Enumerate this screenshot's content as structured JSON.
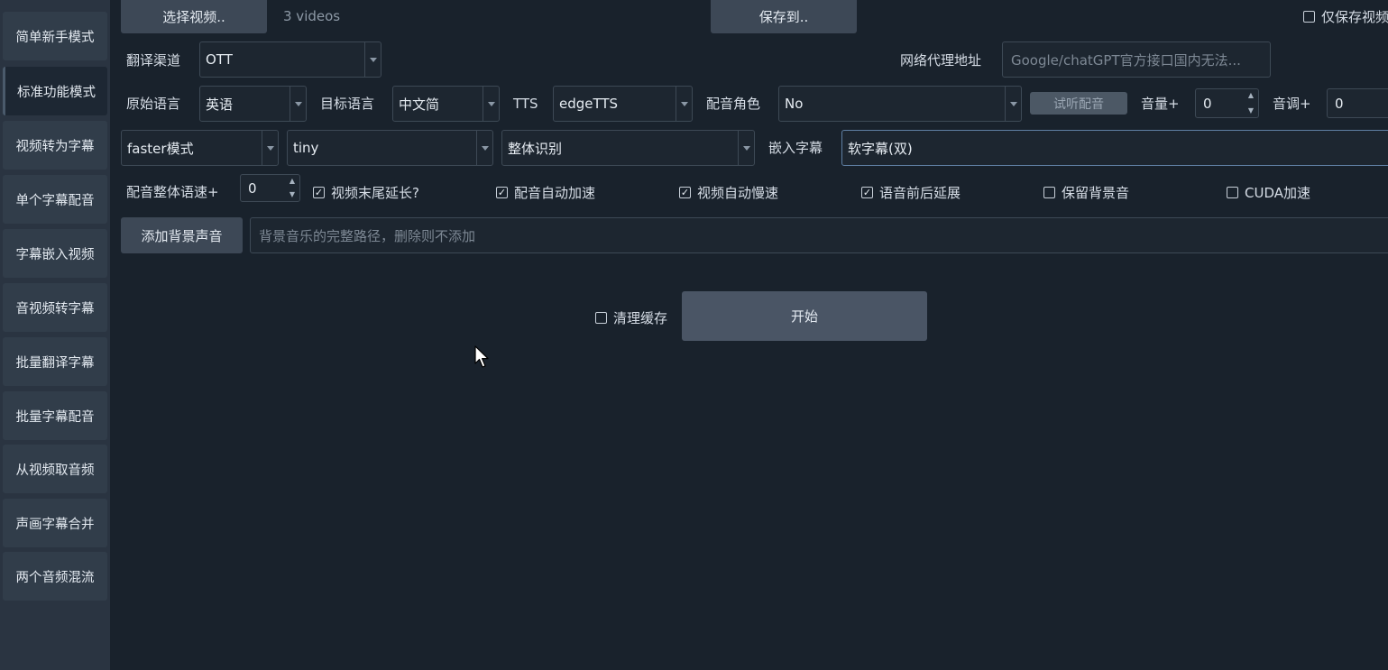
{
  "sidebar": {
    "items": [
      {
        "label": "简单新手模式"
      },
      {
        "label": "标准功能模式"
      },
      {
        "label": "视频转为字幕"
      },
      {
        "label": "单个字幕配音"
      },
      {
        "label": "字幕嵌入视频"
      },
      {
        "label": "音视频转字幕"
      },
      {
        "label": "批量翻译字幕"
      },
      {
        "label": "批量字幕配音"
      },
      {
        "label": "从视频取音频"
      },
      {
        "label": "声画字幕合并"
      },
      {
        "label": "两个音频混流"
      }
    ],
    "active_index": 1
  },
  "top": {
    "select_video_label": "选择视频..",
    "video_count": "3 videos",
    "save_to_label": "保存到..",
    "only_save_video_label": "仅保存视频"
  },
  "row1": {
    "channel_label": "翻译渠道",
    "channel_value": "OTT",
    "proxy_label": "网络代理地址",
    "proxy_placeholder": "Google/chatGPT官方接口国内无法..."
  },
  "row2": {
    "source_lang_label": "原始语言",
    "source_lang_value": "英语",
    "target_lang_label": "目标语言",
    "target_lang_value": "中文简",
    "tts_label": "TTS",
    "tts_value": "edgeTTS",
    "voice_role_label": "配音角色",
    "voice_role_value": "No",
    "listen_label": "试听配音",
    "volume_label": "音量+",
    "volume_value": "0",
    "pitch_label": "音调+",
    "pitch_value": "0"
  },
  "row3": {
    "mode_value": "faster模式",
    "model_value": "tiny",
    "recognition_value": "整体识别",
    "embed_sub_label": "嵌入字幕",
    "embed_sub_value": "软字幕(双)"
  },
  "row4": {
    "speed_label": "配音整体语速+",
    "speed_value": "0",
    "checkboxes": [
      {
        "label": "视频末尾延长?",
        "checked": true
      },
      {
        "label": "配音自动加速",
        "checked": true
      },
      {
        "label": "视频自动慢速",
        "checked": true
      },
      {
        "label": "语音前后延展",
        "checked": true
      },
      {
        "label": "保留背景音",
        "checked": false
      },
      {
        "label": "CUDA加速",
        "checked": false
      }
    ]
  },
  "row5": {
    "add_bgm_label": "添加背景声音",
    "bgm_placeholder": "背景音乐的完整路径，删除则不添加"
  },
  "bottom": {
    "clear_cache_label": "清理缓存",
    "clear_cache_checked": false,
    "start_label": "开始"
  }
}
